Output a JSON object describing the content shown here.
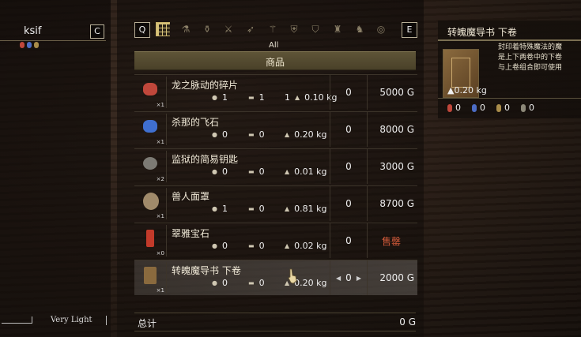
{
  "player": {
    "name": "ksif",
    "close_key": "C",
    "weight_label": "Very Light"
  },
  "tabs": {
    "left_key": "Q",
    "right_key": "E",
    "category": "All"
  },
  "section_title": "商品",
  "items": [
    {
      "name": "龙之脉动的碎片",
      "qty": "×1",
      "stat1": "1",
      "stat2": "1",
      "stat3": "1",
      "weight": "0.10 kg",
      "stock": "0",
      "price": "5000 G",
      "gem_color": "#c0473b"
    },
    {
      "name": "杀那的飞石",
      "qty": "×1",
      "stat1": "0",
      "stat2": "0",
      "stat3": "",
      "weight": "0.20 kg",
      "stock": "0",
      "price": "8000 G",
      "gem_color": "#3f6fd0"
    },
    {
      "name": "监狱的简易钥匙",
      "qty": "×2",
      "stat1": "0",
      "stat2": "0",
      "stat3": "",
      "weight": "0.01 kg",
      "stock": "0",
      "price": "3000 G",
      "gem_color": "#7c7a74"
    },
    {
      "name": "兽人面罩",
      "qty": "×1",
      "stat1": "1",
      "stat2": "0",
      "stat3": "",
      "weight": "0.81 kg",
      "stock": "0",
      "price": "8700 G",
      "gem_color": "#a08a6a"
    },
    {
      "name": "翠雅宝石",
      "qty": "×0",
      "stat1": "0",
      "stat2": "0",
      "stat3": "",
      "weight": "0.02 kg",
      "stock": "0",
      "price": "售罄",
      "gem_color": "#c23a2a"
    },
    {
      "name": "转魄魔导书 下卷",
      "qty": "×1",
      "stat1": "0",
      "stat2": "0",
      "stat3": "",
      "weight": "0.20 kg",
      "stock": "0",
      "price": "2000 G",
      "gem_color": "#8a6a3e"
    }
  ],
  "total": {
    "label": "总计",
    "value": "0 G"
  },
  "detail": {
    "title": "转魄魔导书 下卷",
    "description": "封印着特殊魔法的魔\n是上下两卷中的下卷\n与上卷组合即可使用",
    "weight": "0.20 kg",
    "resist": [
      "0",
      "0",
      "0",
      "0"
    ]
  },
  "colors": {
    "sold_out": "#d35a3a",
    "tab_selected": "#d7c279"
  }
}
